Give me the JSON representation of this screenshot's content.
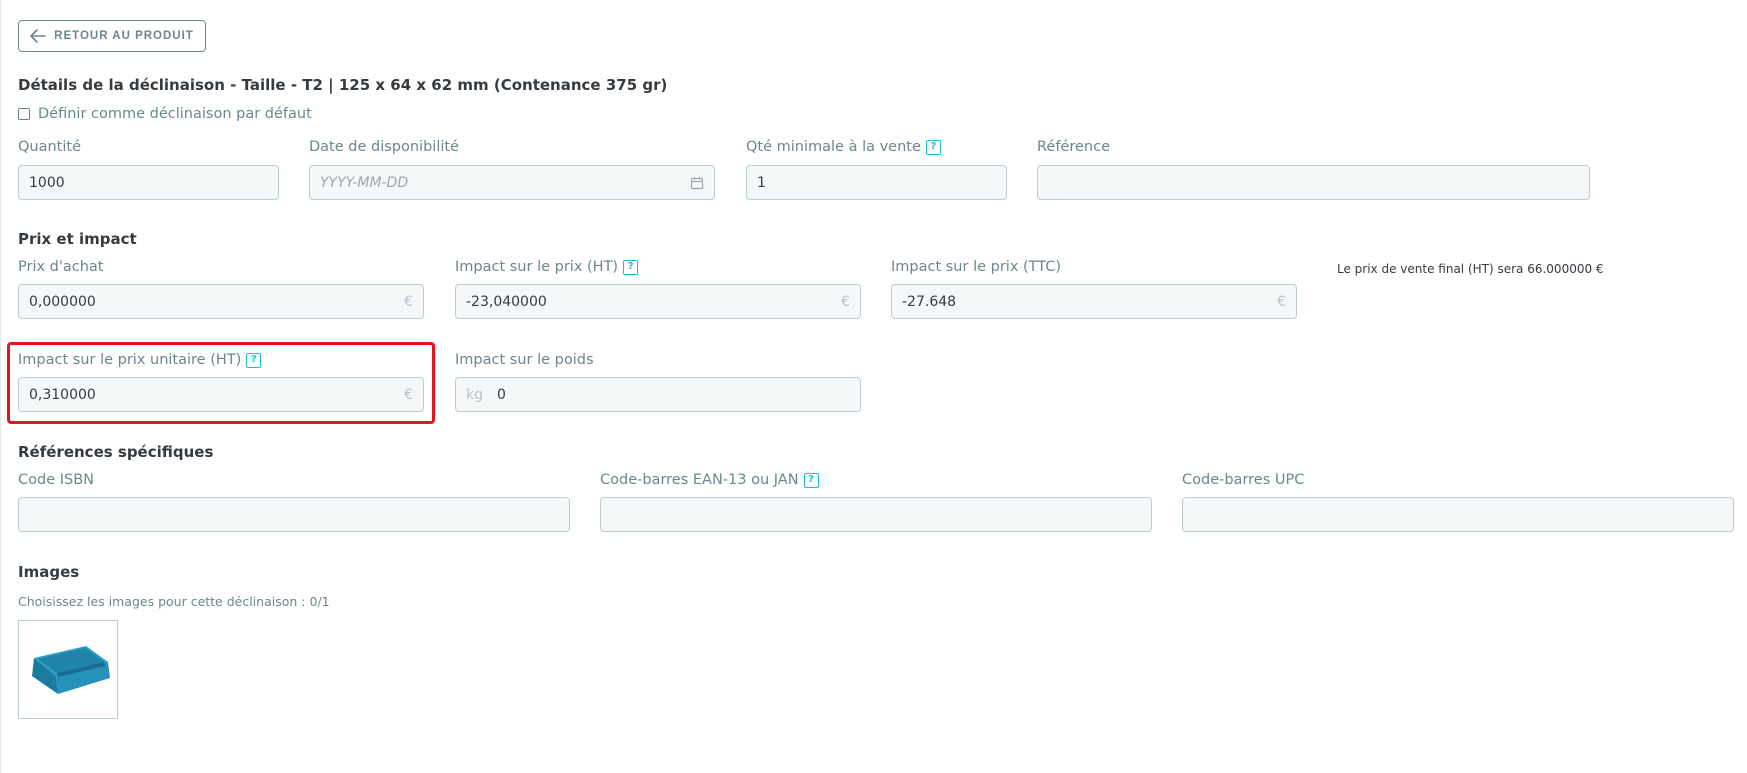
{
  "back_button": {
    "label": "RETOUR AU PRODUIT",
    "icon": "arrow-left-icon"
  },
  "title": "Détails de la déclinaison - Taille - T2 | 125 x 64 x 62 mm (Contenance 375 gr)",
  "default_checkbox": {
    "label": "Définir comme déclinaison par défaut",
    "checked": false
  },
  "stock": {
    "quantity": {
      "label": "Quantité",
      "value": "1000"
    },
    "availability_date": {
      "label": "Date de disponibilité",
      "value": "",
      "placeholder": "YYYY-MM-DD"
    },
    "min_qty": {
      "label": "Qté minimale à la vente",
      "value": "1"
    },
    "reference": {
      "label": "Référence",
      "value": ""
    }
  },
  "price_section": {
    "title": "Prix et impact",
    "purchase_price": {
      "label": "Prix d'achat",
      "value": "0,000000",
      "suffix": "€"
    },
    "impact_ht": {
      "label": "Impact sur le prix (HT)",
      "value": "-23,040000",
      "suffix": "€"
    },
    "impact_ttc": {
      "label": "Impact sur le prix (TTC)",
      "value": "-27.648",
      "suffix": "€"
    },
    "final_price_note": "Le prix de vente final (HT) sera 66.000000 €",
    "unit_impact": {
      "label": "Impact sur le prix unitaire (HT)",
      "value": "0,310000",
      "suffix": "€"
    },
    "weight_impact": {
      "label": "Impact sur le poids",
      "value": "0",
      "prefix": "kg"
    }
  },
  "refs_section": {
    "title": "Références spécifiques",
    "isbn": {
      "label": "Code ISBN",
      "value": ""
    },
    "ean13": {
      "label": "Code-barres EAN-13 ou JAN",
      "value": ""
    },
    "upc": {
      "label": "Code-barres UPC",
      "value": ""
    }
  },
  "images_section": {
    "title": "Images",
    "hint": "Choisissez les images pour cette déclinaison : 0/1"
  },
  "help_glyph": "?",
  "colors": {
    "accent": "#25b9d7",
    "highlight": "#e5131e",
    "field_bg": "#f5f8f9",
    "field_border": "#bbcdd2",
    "label": "#6c868e"
  }
}
